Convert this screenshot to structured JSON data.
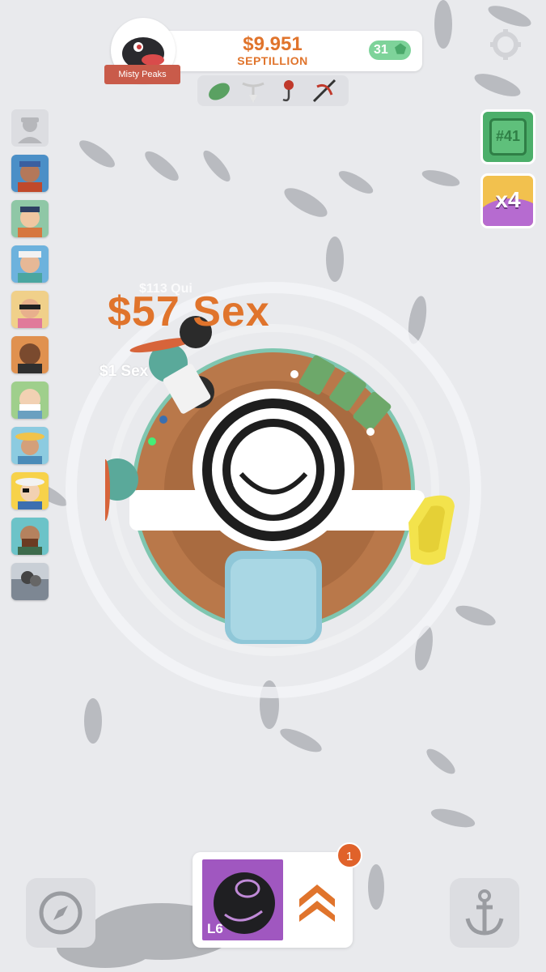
{
  "header": {
    "money_amount": "$9.951",
    "money_unit": "SEPTILLION",
    "gems": "31",
    "location_name": "Misty Peaks"
  },
  "lures": [
    "leaf-lure-icon",
    "antler-lure-icon",
    "fly-hook-icon",
    "crossbow-icon"
  ],
  "crew": [
    "locked-slot",
    "fisher-1",
    "fisher-2",
    "fisher-3",
    "fisher-4",
    "fisher-5",
    "fisher-6",
    "fisher-7",
    "fisher-8",
    "fisher-9",
    "fisher-10"
  ],
  "right_buttons": {
    "rank_label": "#41",
    "boost_label": "x4"
  },
  "floating": {
    "big_catch": "$57 Sex",
    "catch_small": "$113 Qui",
    "catch_one": "$1 Sex"
  },
  "bottom": {
    "upgrade_level": "L6",
    "notification_count": "1"
  },
  "colors": {
    "accent": "#e0742c",
    "water": "#e9eaed",
    "deck": "#b9784a",
    "gem": "#7ed39a",
    "rank_button": "#4caf6a",
    "upgrade_tile": "#a057c0",
    "badge": "#e0622a"
  }
}
